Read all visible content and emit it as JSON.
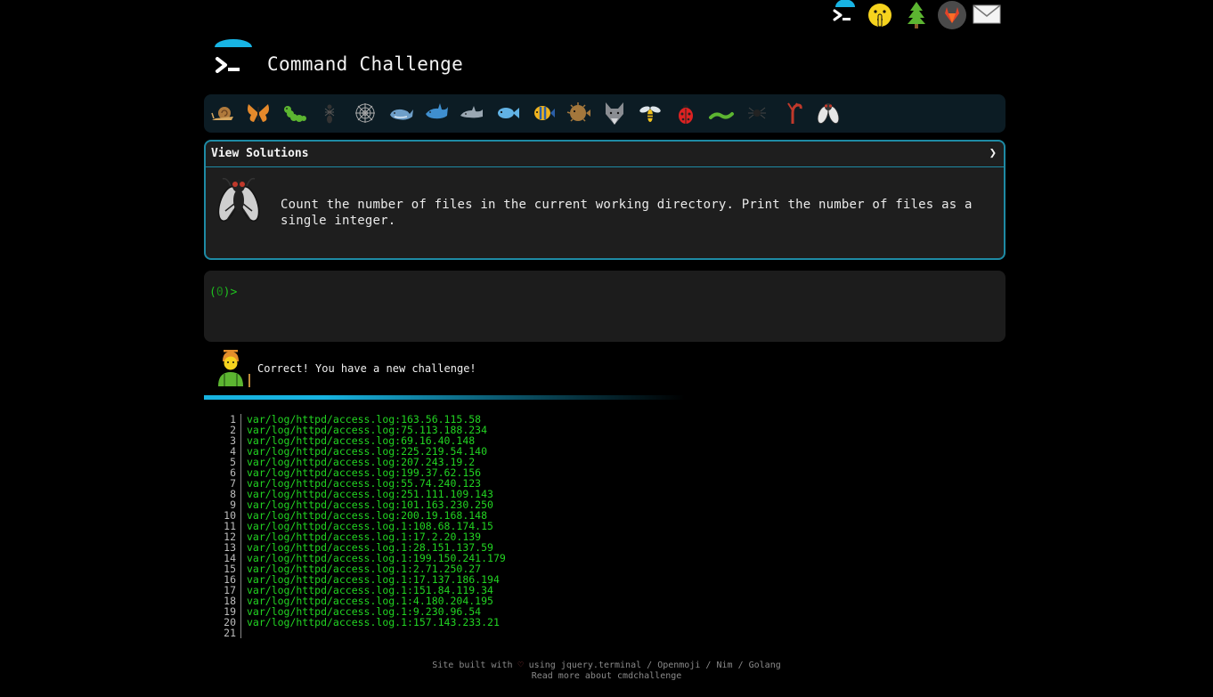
{
  "top_nav": {
    "icons": [
      "terminal-logo",
      "shushing-face",
      "evergreen-tree",
      "gitlab-logo",
      "envelope"
    ]
  },
  "header": {
    "title": "Command Challenge",
    "logo": "terminal-umbrella-logo"
  },
  "challenge_bar": {
    "icons": [
      "snail",
      "butterfly",
      "caterpillar",
      "ant",
      "spider-web",
      "whale",
      "shark",
      "dolphin",
      "fish",
      "tropical-fish",
      "blowfish",
      "wolf",
      "wasp",
      "ladybug",
      "worm",
      "spider",
      "scorpion",
      "fly"
    ]
  },
  "solutions_panel": {
    "label": "View Solutions",
    "chevron": "❯"
  },
  "task": {
    "icon": "fly",
    "text": "Count the number of files in the current working directory. Print the number of files as a single integer."
  },
  "terminal": {
    "prompt_open": "(",
    "prompt_count": "0",
    "prompt_close": ")>"
  },
  "feedback": {
    "avatar": "person-with-cane",
    "message": "Correct! You have a new challenge!",
    "progress_fraction": 0.48
  },
  "output": {
    "lines": [
      {
        "n": "1",
        "text": "var/log/httpd/access.log:163.56.115.58"
      },
      {
        "n": "2",
        "text": "var/log/httpd/access.log:75.113.188.234"
      },
      {
        "n": "3",
        "text": "var/log/httpd/access.log:69.16.40.148"
      },
      {
        "n": "4",
        "text": "var/log/httpd/access.log:225.219.54.140"
      },
      {
        "n": "5",
        "text": "var/log/httpd/access.log:207.243.19.2"
      },
      {
        "n": "6",
        "text": "var/log/httpd/access.log:199.37.62.156"
      },
      {
        "n": "7",
        "text": "var/log/httpd/access.log:55.74.240.123"
      },
      {
        "n": "8",
        "text": "var/log/httpd/access.log:251.111.109.143"
      },
      {
        "n": "9",
        "text": "var/log/httpd/access.log:101.163.230.250"
      },
      {
        "n": "10",
        "text": "var/log/httpd/access.log:200.19.168.148"
      },
      {
        "n": "11",
        "text": "var/log/httpd/access.log.1:108.68.174.15"
      },
      {
        "n": "12",
        "text": "var/log/httpd/access.log.1:17.2.20.139"
      },
      {
        "n": "13",
        "text": "var/log/httpd/access.log.1:28.151.137.59"
      },
      {
        "n": "14",
        "text": "var/log/httpd/access.log.1:199.150.241.179"
      },
      {
        "n": "15",
        "text": "var/log/httpd/access.log.1:2.71.250.27"
      },
      {
        "n": "16",
        "text": "var/log/httpd/access.log.1:17.137.186.194"
      },
      {
        "n": "17",
        "text": "var/log/httpd/access.log.1:151.84.119.34"
      },
      {
        "n": "18",
        "text": "var/log/httpd/access.log.1:4.180.204.195"
      },
      {
        "n": "19",
        "text": "var/log/httpd/access.log.1:9.230.96.54"
      },
      {
        "n": "20",
        "text": "var/log/httpd/access.log.1:157.143.233.21"
      },
      {
        "n": "21",
        "text": ""
      }
    ]
  },
  "footer": {
    "built_with": "Site built with",
    "heart": "♡",
    "using": "using",
    "link_jquery": "jquery.terminal",
    "sep1": "/",
    "link_openmoji": "Openmoji",
    "sep2": "/",
    "link_nim": "Nim",
    "sep3": "/",
    "link_golang": "Golang",
    "read_more": "Read more about cmdchallenge"
  },
  "colors": {
    "accent": "#1e8aa4",
    "progress": "#17b3e0",
    "output_text": "#22d422",
    "prompt": "#1fc11f",
    "bar_bg": "#0c1c24",
    "panel_bg": "#1e1e1e"
  }
}
